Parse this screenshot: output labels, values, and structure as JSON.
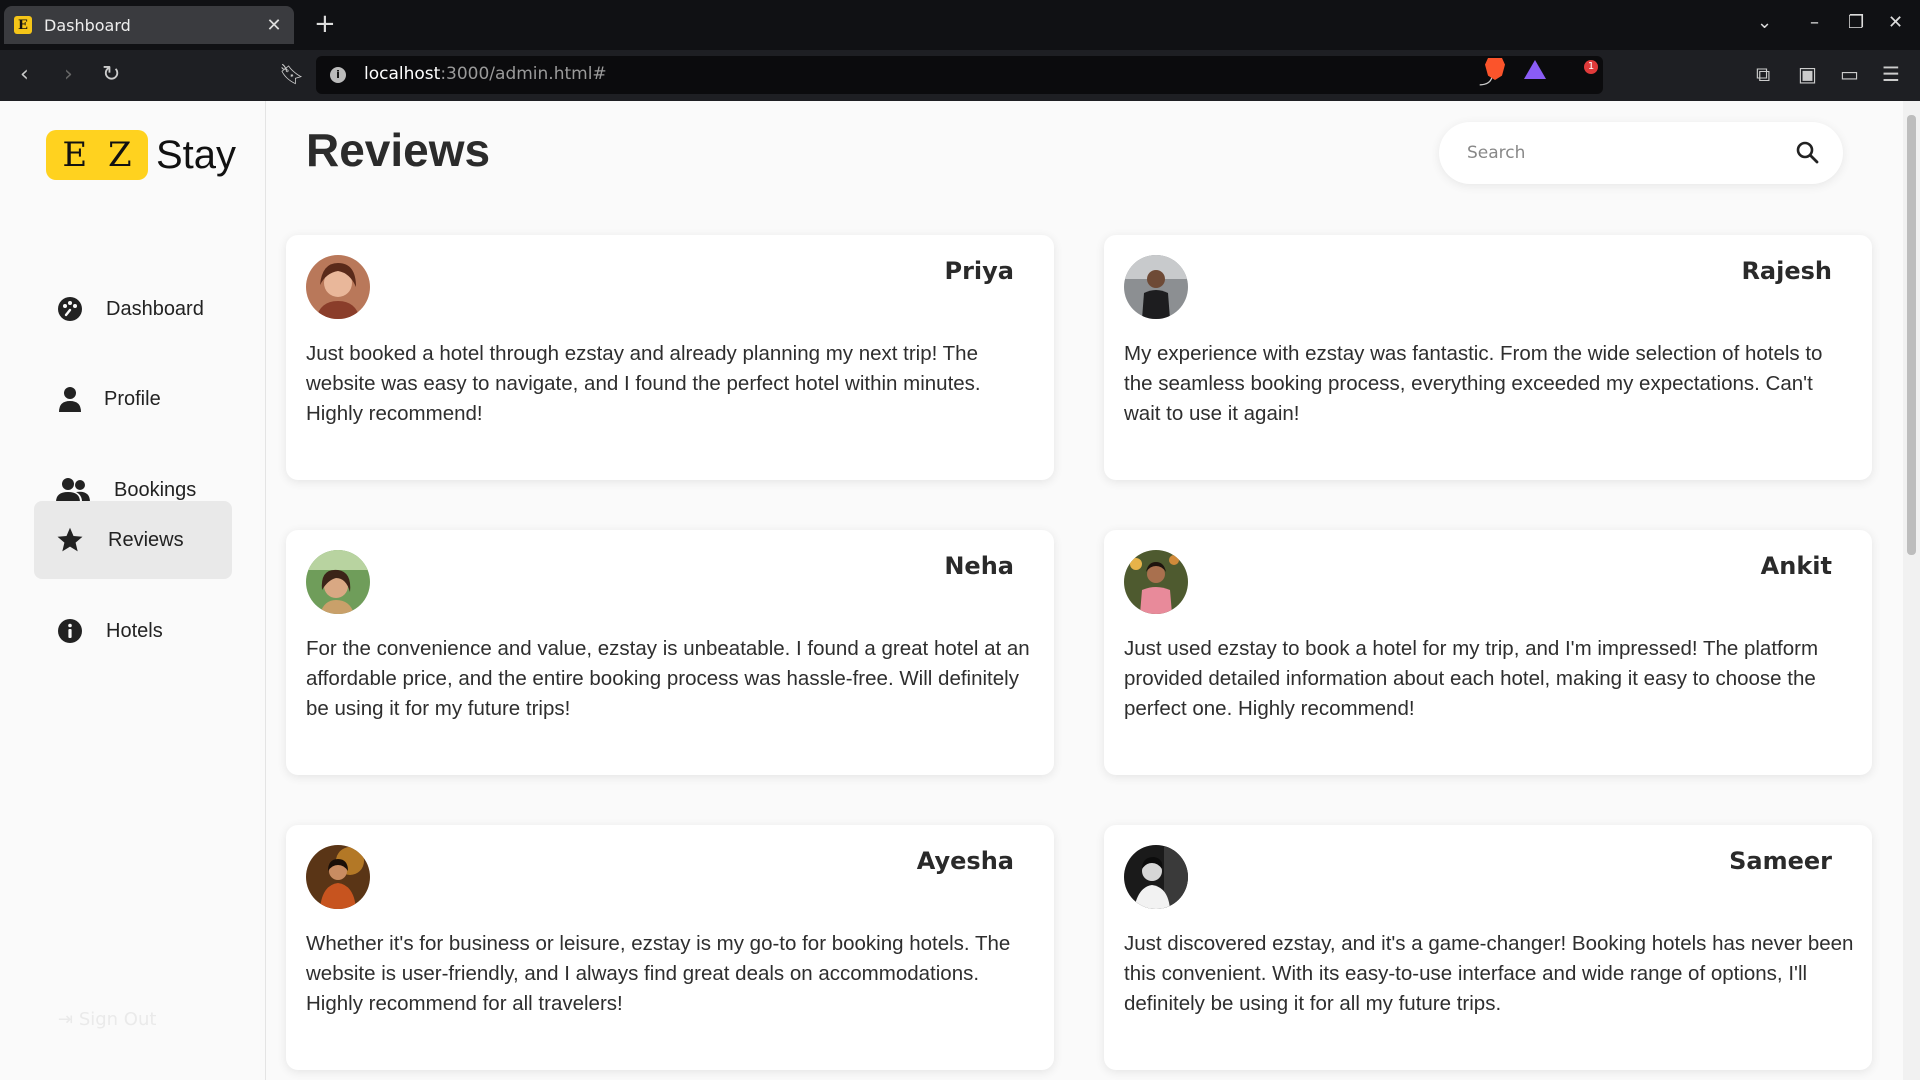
{
  "browser": {
    "tab_title": "Dashboard",
    "tab_favicon": "E",
    "url_host": "localhost",
    "url_rest": ":3000/admin.html#",
    "notification_count": "1"
  },
  "app": {
    "logo": {
      "letter1": "E",
      "letter2": "Z",
      "word": "Stay",
      "brand_color": "#ffd21f"
    },
    "nav": [
      {
        "label": "Dashboard",
        "icon": "palette-icon"
      },
      {
        "label": "Profile",
        "icon": "user-icon"
      },
      {
        "label": "Bookings",
        "icon": "users-icon"
      },
      {
        "label": "Reviews",
        "icon": "star-icon",
        "active": true
      },
      {
        "label": "Hotels",
        "icon": "info-icon"
      }
    ],
    "signout_label": "Sign Out",
    "page_title": "Reviews",
    "search": {
      "placeholder": "Search"
    }
  },
  "reviews": [
    {
      "name": "Priya",
      "text": "Just booked a hotel through ezstay and already planning my next trip! The website was easy to navigate, and I found the perfect hotel within minutes. Highly recommend!"
    },
    {
      "name": "Rajesh",
      "text": "My experience with ezstay was fantastic. From the wide selection of hotels to the seamless booking process, everything exceeded my expectations. Can't wait to use it again!"
    },
    {
      "name": "Neha",
      "text": "For the convenience and value, ezstay is unbeatable. I found a great hotel at an affordable price, and the entire booking process was hassle-free. Will definitely be using it for my future trips!"
    },
    {
      "name": "Ankit",
      "text": "Just used ezstay to book a hotel for my trip, and I'm impressed! The platform provided detailed information about each hotel, making it easy to choose the perfect one. Highly recommend!"
    },
    {
      "name": "Ayesha",
      "text": "Whether it's for business or leisure, ezstay is my go-to for booking hotels. The website is user-friendly, and I always find great deals on accommodations. Highly recommend for all travelers!"
    },
    {
      "name": "Sameer",
      "text": "Just discovered ezstay, and it's a game-changer! Booking hotels has never been this convenient. With its easy-to-use interface and wide range of options, I'll definitely be using it for all my future trips."
    }
  ]
}
